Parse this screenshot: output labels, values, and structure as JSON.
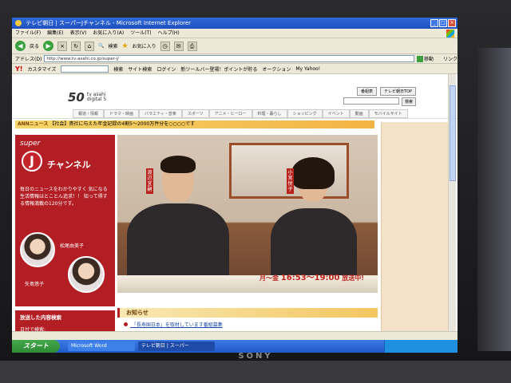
{
  "window": {
    "title": "テレビ朝日 | スーパーJチャンネル - Microsoft Internet Explorer"
  },
  "menu": [
    "ファイル(F)",
    "編集(E)",
    "表示(V)",
    "お気に入り(A)",
    "ツール(T)",
    "ヘルプ(H)"
  ],
  "toolbar": {
    "back": "戻る",
    "search": "検索",
    "favorites": "お気に入り"
  },
  "address": {
    "label": "アドレス(D)",
    "url": "http://www.tv-asahi.co.jp/super-j/",
    "go": "移動",
    "links": "リンク"
  },
  "yahoo_bar": {
    "logo": "Y!",
    "customize": "カスタマイズ",
    "search_btn": "検索",
    "site_search": "サイト検索",
    "login": "ログイン",
    "new_toolbar": "新ツールバー登場！ポイントが貯る",
    "auction": "オークション",
    "my_yahoo": "My Yahoo!"
  },
  "site": {
    "logo_num": "50",
    "logo_text_1": "tv asahi",
    "logo_text_2": "digital 5",
    "hdr_btn_1": "番組表",
    "hdr_btn_2": "テレビ朝日TOP",
    "search_btn": "検索",
    "nav": [
      "報道・情報",
      "ドラマ・映画",
      "バラエティ・音楽",
      "スポーツ",
      "アニメ・ヒーロー",
      "料理・暮らし",
      "ショッピング",
      "イベント",
      "動画",
      "モバイルサイト"
    ],
    "news_label": "ANNニュース",
    "news_text": "【社会】貴社に与えた年金記録の4割5〜2000万件分を○○○○です"
  },
  "program": {
    "super": "super",
    "j": "J",
    "channel": "チャンネル",
    "description": "毎日のニュースをわかりやすく 気になる生活情報はとことん追求！！ 知って得する情報満載の120分です。",
    "anchor_1": "松尾由美子",
    "anchor_2": "矢島悠子",
    "host_1_plate": "渡辺宜嗣",
    "host_2_plate": "小宮悦子",
    "broadcast_days": "月〜金",
    "broadcast_time": "16:53〜19:00",
    "broadcast_suffix": "放送中!"
  },
  "side": {
    "search_heading": "放送した内容検索",
    "search_by_date": "日付で検索:"
  },
  "notice": {
    "heading": "お知らせ",
    "item": "「長寿国日本」を取材しています番組募集"
  },
  "taskbar": {
    "start": "スタート",
    "task_1": "Microsoft Word",
    "task_2": "テレビ朝日 | スーパー"
  },
  "monitor": {
    "brand": "SONY"
  }
}
